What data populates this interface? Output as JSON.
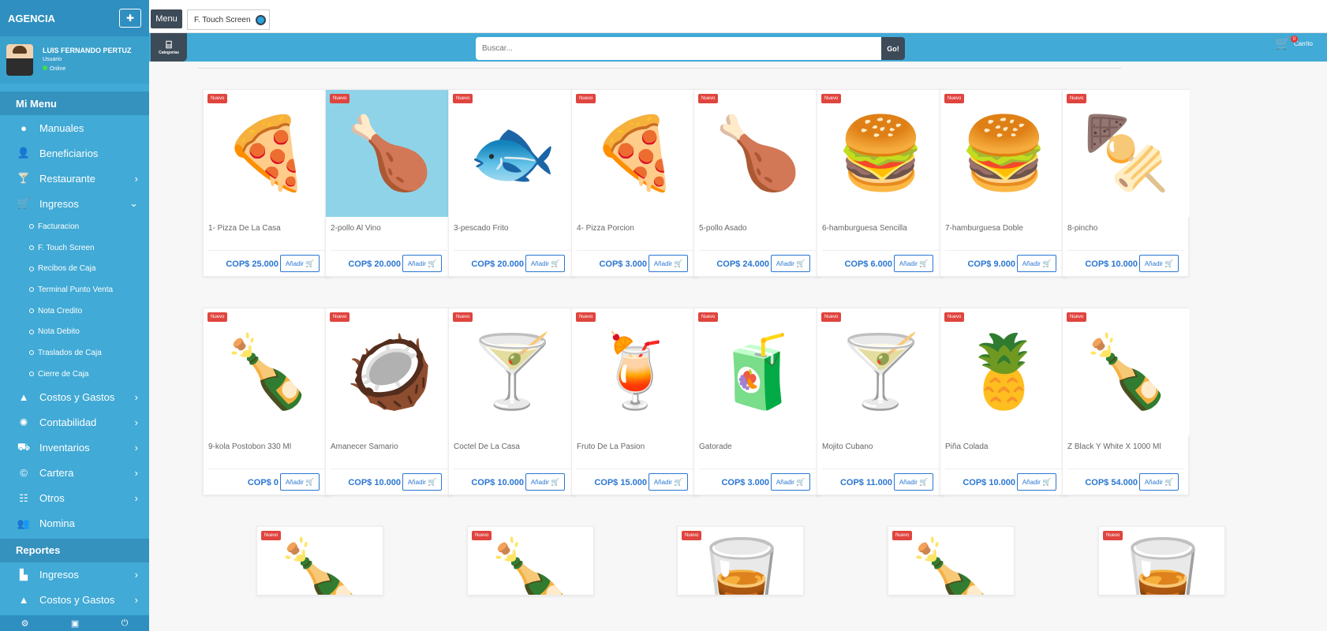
{
  "sidebar": {
    "brand": "AGENCIA",
    "pin_icon": "pin-icon",
    "user": {
      "name": "LUIS FERNANDO PERTUZ",
      "role": "Usuario",
      "status": "Online"
    },
    "menu_header": "Mi Menu",
    "items": [
      {
        "label": "Manuales",
        "icon": "info-icon"
      },
      {
        "label": "Beneficiarios",
        "icon": "user-icon"
      },
      {
        "label": "Restaurante",
        "icon": "cocktail-icon",
        "has_children": true
      },
      {
        "label": "Ingresos",
        "icon": "cart-icon",
        "expanded": true
      }
    ],
    "sub_items": [
      "Facturacion",
      "F. Touch Screen",
      "Recibos de Caja",
      "Terminal Punto Venta",
      "Nota Credito",
      "Nota Debito",
      "Traslados de Caja",
      "Cierre de Caja"
    ],
    "items2": [
      {
        "label": "Costos y Gastos",
        "icon": "drive-icon"
      },
      {
        "label": "Contabilidad",
        "icon": "dharma-icon"
      },
      {
        "label": "Inventarios",
        "icon": "dolly-icon"
      },
      {
        "label": "Cartera",
        "icon": "copyright-icon"
      },
      {
        "label": "Otros",
        "icon": "grid-icon"
      },
      {
        "label": "Nomina",
        "icon": "users-icon"
      }
    ],
    "reports_header": "Reportes",
    "reports": [
      {
        "label": "Ingresos",
        "icon": "chart-icon"
      },
      {
        "label": "Costos y Gastos",
        "icon": "drive-icon"
      }
    ]
  },
  "tabs": {
    "menu": "Menu",
    "touch": "F. Touch Screen"
  },
  "topbar": {
    "categories_label": "Categorías",
    "search_placeholder": "Buscar...",
    "go_label": "Go!",
    "cart_label": "Carrito",
    "cart_count": "0"
  },
  "badge_new": "Nuevo",
  "add_label": "Añadir",
  "products": [
    {
      "name": "1- Pizza De La Casa",
      "price": "COP$ 25.000",
      "emoji": "🍕",
      "bg": "#ffffff"
    },
    {
      "name": "2-pollo Al Vino",
      "price": "COP$ 20.000",
      "emoji": "🍗",
      "bg": "#8fd3e8"
    },
    {
      "name": "3-pescado Frito",
      "price": "COP$ 20.000",
      "emoji": "🐟",
      "bg": "#ffffff"
    },
    {
      "name": "4- Pizza Porcion",
      "price": "COP$ 3.000",
      "emoji": "🍕",
      "bg": "#ffffff"
    },
    {
      "name": "5-pollo Asado",
      "price": "COP$ 24.000",
      "emoji": "🍗",
      "bg": "#ffffff"
    },
    {
      "name": "6-hamburguesa Sencilla",
      "price": "COP$ 6.000",
      "emoji": "🍔",
      "bg": "#ffffff"
    },
    {
      "name": "7-hamburguesa Doble",
      "price": "COP$ 9.000",
      "emoji": "🍔",
      "bg": "#ffffff"
    },
    {
      "name": "8-pincho",
      "price": "COP$ 10.000",
      "emoji": "🍢",
      "bg": "#ffffff"
    },
    {
      "name": "9-kola Postobon 330 Ml",
      "price": "COP$ 0",
      "emoji": "🍾",
      "bg": "#ffffff"
    },
    {
      "name": "Amanecer Samario",
      "price": "COP$ 10.000",
      "emoji": "🥥",
      "bg": "#ffffff"
    },
    {
      "name": "Coctel De La Casa",
      "price": "COP$ 10.000",
      "emoji": "🍸",
      "bg": "#ffffff"
    },
    {
      "name": "Fruto De La Pasion",
      "price": "COP$ 15.000",
      "emoji": "🍹",
      "bg": "#ffffff"
    },
    {
      "name": "Gatorade",
      "price": "COP$ 3.000",
      "emoji": "🧃",
      "bg": "#ffffff"
    },
    {
      "name": "Mojito Cubano",
      "price": "COP$ 11.000",
      "emoji": "🍸",
      "bg": "#ffffff"
    },
    {
      "name": "Piña Colada",
      "price": "COP$ 10.000",
      "emoji": "🍍",
      "bg": "#ffffff"
    },
    {
      "name": "Z Black Y White X 1000 Ml",
      "price": "COP$ 54.000",
      "emoji": "🍾",
      "bg": "#ffffff"
    }
  ],
  "partial_products": [
    {
      "emoji": "🍾"
    },
    {
      "emoji": "🍾"
    },
    {
      "emoji": "🥃"
    },
    {
      "emoji": "🍾"
    },
    {
      "emoji": "🥃"
    }
  ]
}
